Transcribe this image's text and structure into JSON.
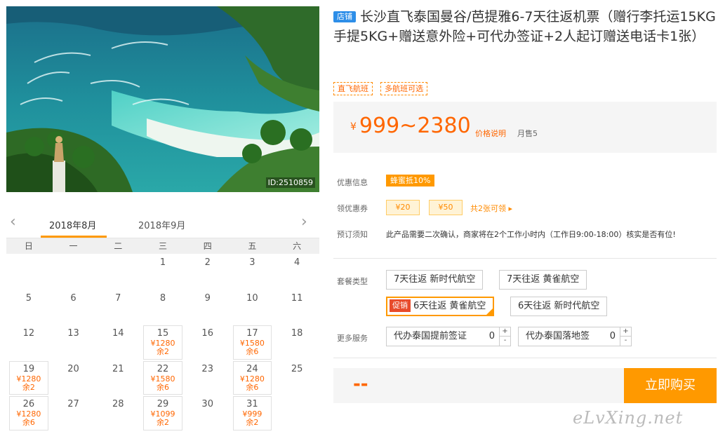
{
  "hero": {
    "image_id": "ID:2510859"
  },
  "calendar": {
    "months": [
      "2018年8月",
      "2018年9月"
    ],
    "weekdays": [
      "日",
      "一",
      "二",
      "三",
      "四",
      "五",
      "六"
    ],
    "cells": [
      {
        "d": ""
      },
      {
        "d": ""
      },
      {
        "d": ""
      },
      {
        "d": "1"
      },
      {
        "d": "2"
      },
      {
        "d": "3"
      },
      {
        "d": "4"
      },
      {
        "d": "5"
      },
      {
        "d": "6"
      },
      {
        "d": "7"
      },
      {
        "d": "8"
      },
      {
        "d": "9"
      },
      {
        "d": "10"
      },
      {
        "d": "11"
      },
      {
        "d": "12"
      },
      {
        "d": "13"
      },
      {
        "d": "14"
      },
      {
        "d": "15",
        "p": "¥1280",
        "r": "余2"
      },
      {
        "d": "16"
      },
      {
        "d": "17",
        "p": "¥1580",
        "r": "余6"
      },
      {
        "d": "18"
      },
      {
        "d": "19",
        "p": "¥1280",
        "r": "余2"
      },
      {
        "d": "20"
      },
      {
        "d": "21"
      },
      {
        "d": "22",
        "p": "¥1580",
        "r": "余6"
      },
      {
        "d": "23"
      },
      {
        "d": "24",
        "p": "¥1280",
        "r": "余6"
      },
      {
        "d": "25"
      },
      {
        "d": "26",
        "p": "¥1280",
        "r": "余6"
      },
      {
        "d": "27"
      },
      {
        "d": "28"
      },
      {
        "d": "29",
        "p": "¥1099",
        "r": "余2"
      },
      {
        "d": "30"
      },
      {
        "d": "31",
        "p": "¥999",
        "r": "余2"
      },
      {
        "d": ""
      }
    ]
  },
  "product": {
    "shop_badge": "店铺",
    "title": "长沙直飞泰国曼谷/芭提雅6-7天往返机票（赠行李托运15KG手提5KG+赠送意外险+可代办签证+2人起订赠送电话卡1张）",
    "tags": [
      "直飞航班",
      "多航班可选"
    ]
  },
  "price": {
    "currency": "¥",
    "range": "999~2380",
    "note_link": "价格说明",
    "monthly_sales": "月售5"
  },
  "offers": {
    "promo_label": "优惠信息",
    "promo_badge": "蜂蜜抵10%",
    "coupon_label": "领优惠券",
    "coupons": [
      "¥20",
      "¥50"
    ],
    "coupon_more": "共2张可领 ▸",
    "notice_label": "预订须知",
    "notice_text": "此产品需要二次确认，商家将在2个工作小时内（工作日9:00-18:00）核实是否有位!"
  },
  "packages": {
    "label": "套餐类型",
    "options": [
      "7天往返 新时代航空",
      "7天往返 黄雀航空",
      "6天往返 黄雀航空",
      "6天往返 新时代航空"
    ],
    "sale_badge": "促销"
  },
  "services": {
    "label": "更多服务",
    "items": [
      {
        "name": "代办泰国提前签证",
        "qty": "0"
      },
      {
        "name": "代办泰国落地签",
        "qty": "0"
      }
    ],
    "plus": "+",
    "minus": "-"
  },
  "buy": {
    "price_placeholder": "--",
    "button": "立即购买"
  },
  "watermark": "eLvXing.net",
  "colors": {
    "accent": "#ff9900",
    "price": "#ff6600",
    "shop_badge": "#2d8ee8",
    "sale_badge": "#e84b2b"
  }
}
